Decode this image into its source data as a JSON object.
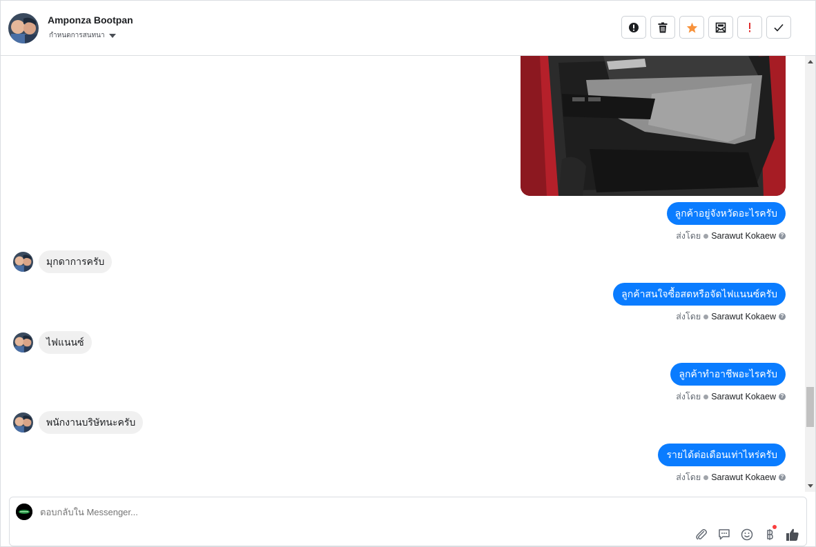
{
  "header": {
    "name": "Amponza Bootpan",
    "stage": "กำหนดการสนทนา",
    "actions": [
      {
        "name": "spam-button",
        "icon": "exclamation-circle-icon"
      },
      {
        "name": "delete-button",
        "icon": "trash-icon"
      },
      {
        "name": "star-button",
        "icon": "star-icon",
        "color": "#f7923b"
      },
      {
        "name": "mark-unread-button",
        "icon": "envelope-open-icon"
      },
      {
        "name": "follow-up-button",
        "icon": "exclamation-icon",
        "color": "#e02d2d"
      },
      {
        "name": "mark-done-button",
        "icon": "checkmark-icon"
      }
    ]
  },
  "messages": [
    {
      "dir": "out",
      "text": "ลูกค้าอยู่จังหวัดอะไรครับ",
      "sent_by_prefix": "ส่งโดย",
      "sender": "Sarawut Kokaew"
    },
    {
      "dir": "in",
      "text": "มุกดาการครับ"
    },
    {
      "dir": "out",
      "text": "ลูกค้าสนใจซื้อสดหรือจัดไฟแนนซ์ครับ",
      "sent_by_prefix": "ส่งโดย",
      "sender": "Sarawut Kokaew"
    },
    {
      "dir": "in",
      "text": "ไฟแนนซ์"
    },
    {
      "dir": "out",
      "text": "ลูกค้าทำอาชีพอะไรครับ",
      "sent_by_prefix": "ส่งโดย",
      "sender": "Sarawut Kokaew"
    },
    {
      "dir": "in",
      "text": "พนักงานบริษัทนะครับ"
    },
    {
      "dir": "out",
      "text": "รายได้ต่อเดือนเท่าไหร่ครับ",
      "sent_by_prefix": "ส่งโดย",
      "sender": "Sarawut Kokaew"
    }
  ],
  "composer": {
    "placeholder": "ตอบกลับใน Messenger...",
    "tools": [
      "paperclip-icon",
      "quick-reply-icon",
      "emoji-icon",
      "baht-icon",
      "like-icon"
    ]
  },
  "colors": {
    "outgoing_bubble": "#0a7cff",
    "incoming_bubble": "#f0f0f0",
    "star": "#f7923b",
    "alert": "#e02d2d"
  }
}
